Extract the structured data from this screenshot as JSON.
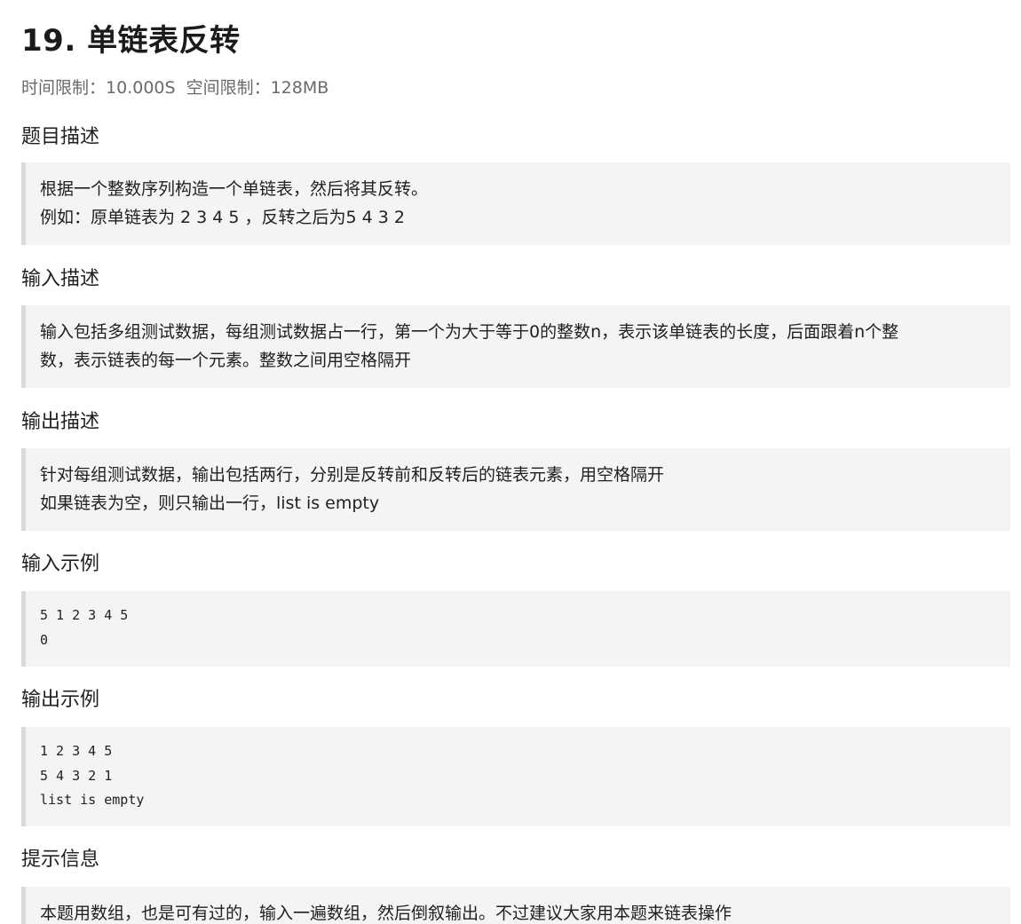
{
  "problem": {
    "title": "19. 单链表反转",
    "time_limit_label": "时间限制：",
    "time_limit_value": "10.000S",
    "memory_limit_label": "空间限制：",
    "memory_limit_value": "128MB"
  },
  "sections": {
    "description": {
      "heading": "题目描述",
      "lines": [
        "根据一个整数序列构造一个单链表，然后将其反转。",
        "例如：原单链表为 2 3 4 5 ，反转之后为5 4 3 2"
      ]
    },
    "input": {
      "heading": "输入描述",
      "lines": [
        "输入包括多组测试数据，每组测试数据占一行，第一个为大于等于0的整数n，表示该单链表的长度，后面跟着n个整",
        "数，表示链表的每一个元素。整数之间用空格隔开"
      ]
    },
    "output": {
      "heading": "输出描述",
      "lines": [
        "针对每组测试数据，输出包括两行，分别是反转前和反转后的链表元素，用空格隔开",
        "如果链表为空，则只输出一行，list is empty"
      ]
    },
    "sample_input": {
      "heading": "输入示例",
      "lines": [
        "5 1 2 3 4 5",
        "0"
      ]
    },
    "sample_output": {
      "heading": "输出示例",
      "lines": [
        "1 2 3 4 5",
        "5 4 3 2 1",
        "list is empty"
      ]
    },
    "hint": {
      "heading": "提示信息",
      "lines": [
        "本题用数组，也是可有过的，输入一遍数组，然后倒叙输出。不过建议大家用本题来链表操作"
      ]
    }
  }
}
